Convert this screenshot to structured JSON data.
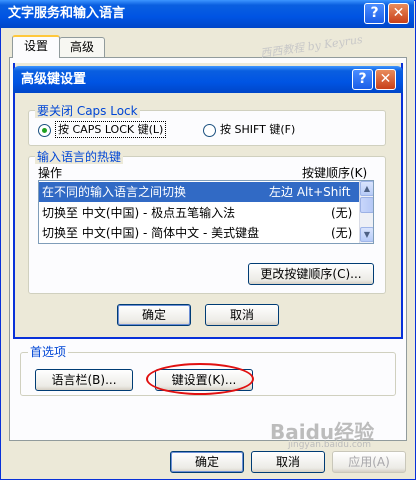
{
  "outer": {
    "title": "文字服务和输入语言",
    "help_glyph": "?",
    "close_glyph": "✕",
    "tabs": [
      "设置",
      "高级"
    ],
    "preferences": {
      "group_title": "首选项",
      "language_bar_button": "语言栏(B)...",
      "key_settings_button": "键设置(K)..."
    },
    "buttons": {
      "ok": "确定",
      "cancel": "取消",
      "apply": "应用(A)"
    }
  },
  "inner": {
    "title": "高级键设置",
    "help_glyph": "?",
    "close_glyph": "✕",
    "caps_group": {
      "title": "要关闭 Caps Lock",
      "option1": "按 CAPS LOCK 键(L)",
      "option2": "按 SHIFT 键(F)",
      "selected": "option1"
    },
    "hotkey_group": {
      "title": "输入语言的热键",
      "col_action": "操作",
      "col_sequence": "按键顺序(K)",
      "rows": [
        {
          "action": "在不同的输入语言之间切换",
          "sequence": "左边 Alt+Shift",
          "selected": true
        },
        {
          "action": "切换至 中文(中国) - 极点五笔输入法",
          "sequence": "(无)",
          "selected": false
        },
        {
          "action": "切换至 中文(中国) - 简体中文 - 美式键盘",
          "sequence": "(无)",
          "selected": false
        }
      ],
      "change_button": "更改按键顺序(C)..."
    },
    "buttons": {
      "ok": "确定",
      "cancel": "取消"
    }
  },
  "overlay": {
    "watermark_script": "西西教程 by Keyrus",
    "baidu_logo": "Baidu经验",
    "baidu_url": "jingyan.baidu.com"
  },
  "colors": {
    "title_blue": "#0054e3",
    "group_title_blue": "#0046d5",
    "selection": "#316ac5",
    "highlight_ring": "#e01010"
  }
}
